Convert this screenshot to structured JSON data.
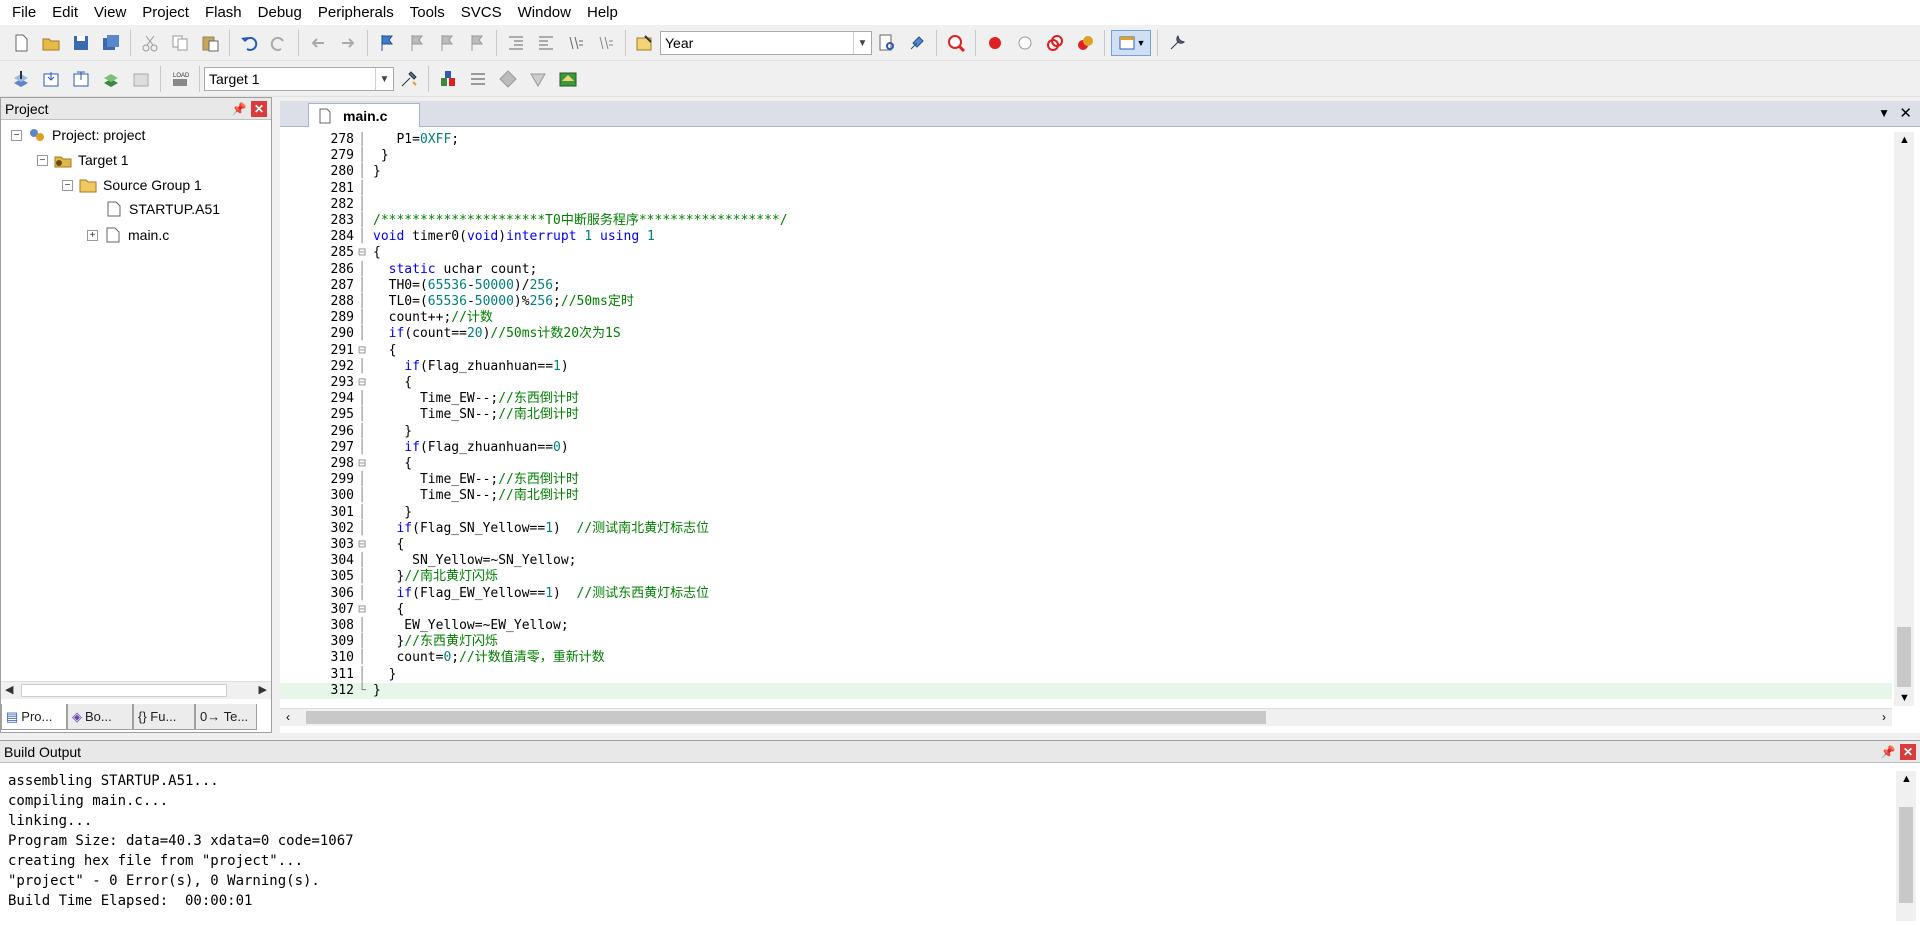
{
  "menu": [
    "File",
    "Edit",
    "View",
    "Project",
    "Flash",
    "Debug",
    "Peripherals",
    "Tools",
    "SVCS",
    "Window",
    "Help"
  ],
  "toolbar1": {
    "find_combo_value": "Year"
  },
  "toolbar2": {
    "target_combo_value": "Target 1"
  },
  "project_panel": {
    "title": "Project",
    "tree": {
      "project": "Project: project",
      "target": "Target 1",
      "group": "Source Group 1",
      "file1": "STARTUP.A51",
      "file2": "main.c"
    },
    "tabs": [
      "Pro...",
      "Bo...",
      "{} Fu...",
      "0→ Te..."
    ]
  },
  "editor": {
    "active_tab": "main.c",
    "lines": [
      {
        "n": "278",
        "t": "   P1=0XFF;"
      },
      {
        "n": "279",
        "t": " }"
      },
      {
        "n": "280",
        "t": "}"
      },
      {
        "n": "281",
        "t": ""
      },
      {
        "n": "282",
        "t": ""
      },
      {
        "n": "283",
        "t": "/*********************T0中断服务程序******************/"
      },
      {
        "n": "284",
        "t": "void timer0(void)interrupt 1 using 1"
      },
      {
        "n": "285",
        "t": "{"
      },
      {
        "n": "286",
        "t": "  static uchar count;"
      },
      {
        "n": "287",
        "t": "  TH0=(65536-50000)/256;"
      },
      {
        "n": "288",
        "t": "  TL0=(65536-50000)%256;//50ms定时"
      },
      {
        "n": "289",
        "t": "  count++;//计数"
      },
      {
        "n": "290",
        "t": "  if(count==20)//50ms计数20次为1S"
      },
      {
        "n": "291",
        "t": "  {"
      },
      {
        "n": "292",
        "t": "    if(Flag_zhuanhuan==1)"
      },
      {
        "n": "293",
        "t": "    {"
      },
      {
        "n": "294",
        "t": "      Time_EW--;//东西倒计时"
      },
      {
        "n": "295",
        "t": "      Time_SN--;//南北倒计时"
      },
      {
        "n": "296",
        "t": "    }"
      },
      {
        "n": "297",
        "t": "    if(Flag_zhuanhuan==0)"
      },
      {
        "n": "298",
        "t": "    {"
      },
      {
        "n": "299",
        "t": "      Time_EW--;//东西倒计时"
      },
      {
        "n": "300",
        "t": "      Time_SN--;//南北倒计时"
      },
      {
        "n": "301",
        "t": "    }"
      },
      {
        "n": "302",
        "t": "   if(Flag_SN_Yellow==1)  //测试南北黄灯标志位"
      },
      {
        "n": "303",
        "t": "   {"
      },
      {
        "n": "304",
        "t": "     SN_Yellow=~SN_Yellow;"
      },
      {
        "n": "305",
        "t": "   }//南北黄灯闪烁"
      },
      {
        "n": "306",
        "t": "   if(Flag_EW_Yellow==1)  //测试东西黄灯标志位"
      },
      {
        "n": "307",
        "t": "   {"
      },
      {
        "n": "308",
        "t": "    EW_Yellow=~EW_Yellow;"
      },
      {
        "n": "309",
        "t": "   }//东西黄灯闪烁"
      },
      {
        "n": "310",
        "t": "   count=0;//计数值清零，重新计数"
      },
      {
        "n": "311",
        "t": "  }"
      },
      {
        "n": "312",
        "t": "}"
      }
    ]
  },
  "build_output": {
    "title": "Build Output",
    "lines": [
      "assembling STARTUP.A51...",
      "compiling main.c...",
      "linking...",
      "Program Size: data=40.3 xdata=0 code=1067",
      "creating hex file from \"project\"...",
      "\"project\" - 0 Error(s), 0 Warning(s).",
      "Build Time Elapsed:  00:00:01"
    ]
  },
  "colors": {
    "keyword": "#0000ff",
    "number": "#008080",
    "comment": "#008000",
    "current_line": "#e6f6e9"
  }
}
